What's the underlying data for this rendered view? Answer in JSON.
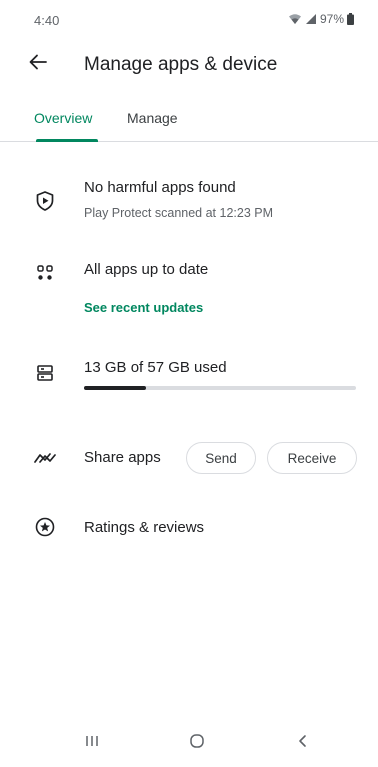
{
  "status_bar": {
    "time": "4:40",
    "battery_text": "97%",
    "icons": [
      "wifi-icon",
      "signal-icon",
      "battery-icon"
    ]
  },
  "header": {
    "title": "Manage apps & device",
    "back_icon": "arrow-back-icon"
  },
  "tabs": [
    {
      "label": "Overview",
      "selected": true
    },
    {
      "label": "Manage",
      "selected": false
    }
  ],
  "protect": {
    "icon": "play-protect-shield-icon",
    "title": "No harmful apps found",
    "subtitle": "Play Protect scanned at 12:23 PM"
  },
  "updates": {
    "icon": "apps-grid-icon",
    "title": "All apps up to date",
    "link": "See recent updates"
  },
  "storage": {
    "icon": "storage-icon",
    "text": "13 GB of 57 GB used",
    "used_gb": 13,
    "total_gb": 57
  },
  "share": {
    "icon": "share-apps-icon",
    "label": "Share apps",
    "send_label": "Send",
    "receive_label": "Receive"
  },
  "ratings": {
    "icon": "star-circle-icon",
    "label": "Ratings & reviews"
  },
  "nav_bar": {
    "icons": [
      "recents-icon",
      "home-icon",
      "back-icon"
    ]
  },
  "colors": {
    "accent": "#01875f",
    "text": "#202124",
    "secondary_text": "#5f6368",
    "divider": "#dadce0"
  }
}
